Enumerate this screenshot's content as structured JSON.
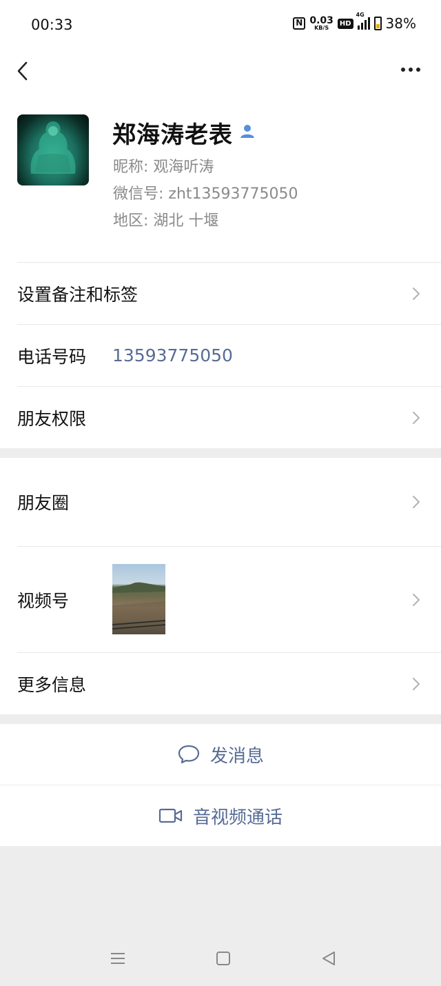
{
  "status_bar": {
    "time": "00:33",
    "nfc": "N",
    "net_speed_value": "0.03",
    "net_speed_unit": "KB/S",
    "hd": "HD",
    "network": "4G",
    "battery": "38%"
  },
  "profile": {
    "display_name": "郑海涛老表",
    "nickname": "昵称:  观海听涛",
    "wechat_id": "微信号:  zht13593775050",
    "region": "地区:  湖北  十堰"
  },
  "rows": {
    "remarks": "设置备注和标签",
    "phone_label": "电话号码",
    "phone_value": "13593775050",
    "permissions": "朋友权限",
    "moments": "朋友圈",
    "channels": "视频号",
    "more_info": "更多信息"
  },
  "actions": {
    "message": "发消息",
    "call": "音视频通话"
  },
  "colors": {
    "link": "#576b95",
    "background": "#ededed"
  },
  "icons": [
    "back-icon",
    "more-icon",
    "person-icon",
    "chevron-right-icon",
    "chat-bubble-icon",
    "video-camera-icon",
    "nav-menu-icon",
    "nav-home-icon",
    "nav-back-icon"
  ]
}
